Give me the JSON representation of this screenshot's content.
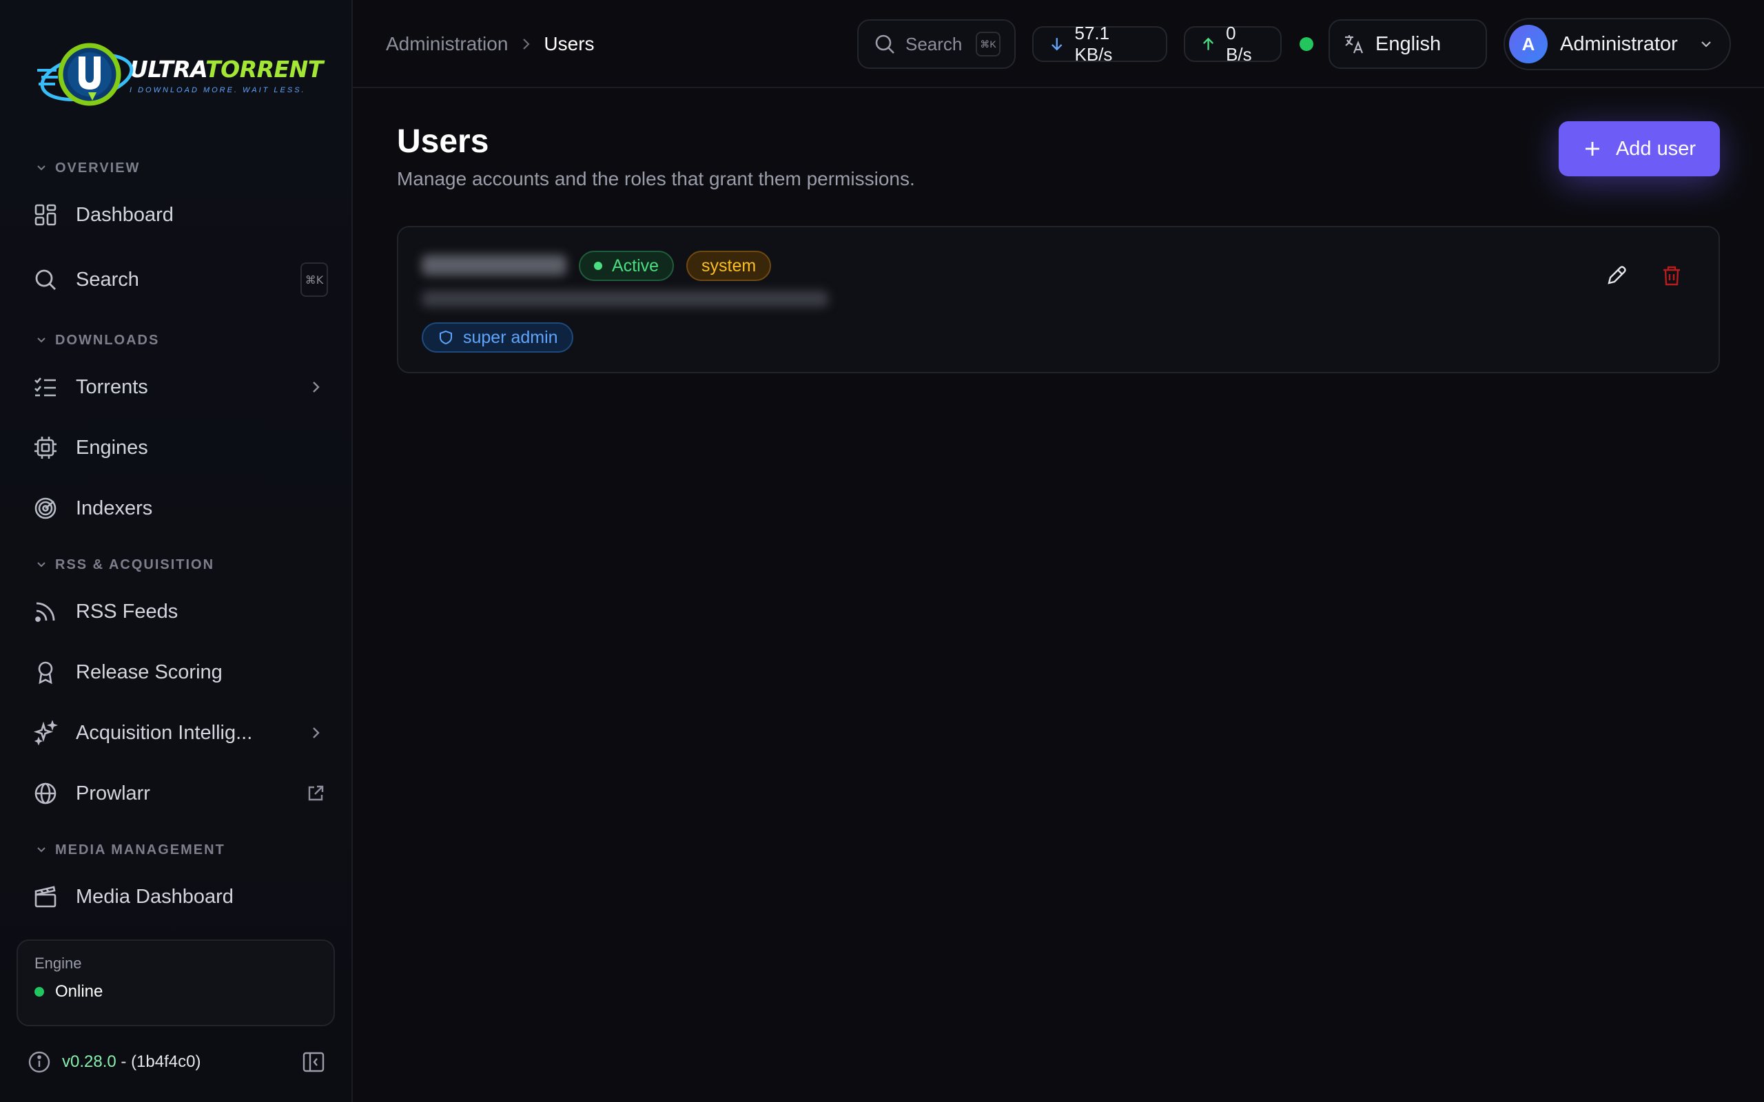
{
  "app": {
    "logo_word_main": "ULTRA",
    "logo_word_accent": "TORRENT",
    "logo_tagline": "I DOWNLOAD MORE. WAIT LESS."
  },
  "sidebar": {
    "sections": {
      "overview": "OVERVIEW",
      "downloads": "DOWNLOADS",
      "rss": "RSS & ACQUISITION",
      "media": "MEDIA MANAGEMENT"
    },
    "items": [
      {
        "label": "Dashboard",
        "icon": "dashboard-icon"
      },
      {
        "label": "Search",
        "icon": "search-icon",
        "shortcut": "⌘K"
      },
      {
        "label": "Torrents",
        "icon": "list-check-icon"
      },
      {
        "label": "Engines",
        "icon": "chip-icon"
      },
      {
        "label": "Indexers",
        "icon": "radar-icon"
      },
      {
        "label": "RSS Feeds",
        "icon": "rss-icon"
      },
      {
        "label": "Release Scoring",
        "icon": "award-icon"
      },
      {
        "label": "Acquisition Intellig...",
        "icon": "sparkles-icon"
      },
      {
        "label": "Prowlarr",
        "icon": "globe-icon"
      },
      {
        "label": "Media Dashboard",
        "icon": "clapperboard-icon"
      }
    ],
    "engine": {
      "title": "Engine",
      "status": "Online",
      "status_color": "#22c55e"
    },
    "version": {
      "number": "v0.28.0",
      "hash": " - (1b4f4c0)"
    }
  },
  "topbar": {
    "breadcrumb": [
      "Administration",
      "Users"
    ],
    "search_placeholder": "Search",
    "search_shortcut": "⌘K",
    "download_speed": "57.1 KB/s",
    "upload_speed": "0 B/s",
    "language": "English",
    "user_initial": "A",
    "user_name": "Administrator"
  },
  "main": {
    "title": "Users",
    "subtitle": "Manage accounts and the roles that grant them permissions.",
    "add_button": "Add user",
    "accent_color": "#6d5cf6",
    "users": [
      {
        "status": "Active",
        "tag": "system",
        "role": "super admin"
      }
    ]
  }
}
